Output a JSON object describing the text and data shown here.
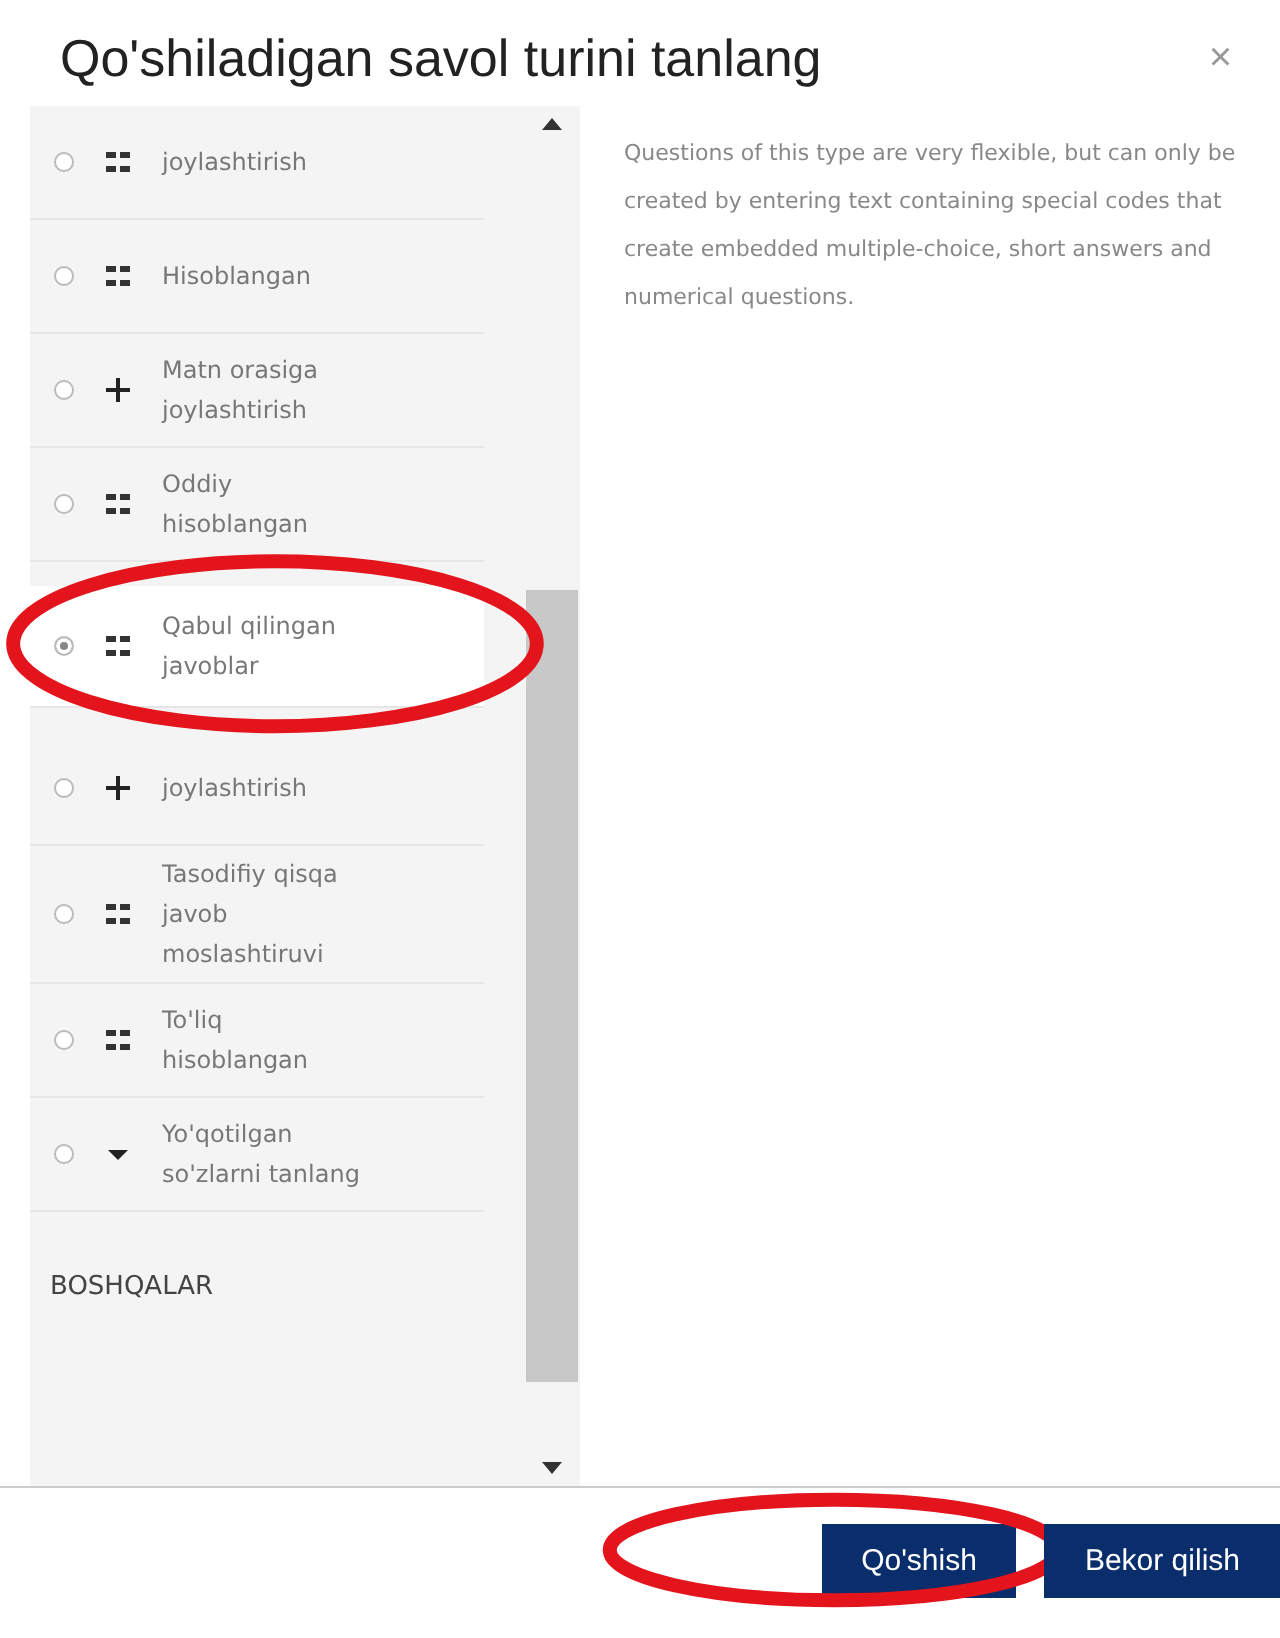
{
  "dialog": {
    "title": "Qo'shiladigan savol turini tanlang",
    "close": "×"
  },
  "question_types": [
    {
      "label": "joylashtirish",
      "selected": false
    },
    {
      "label": "Hisoblangan",
      "selected": false
    },
    {
      "label": "Matn orasiga joylashtirish",
      "selected": false
    },
    {
      "label": "Oddiy hisoblangan",
      "selected": false
    },
    {
      "label": "Qabul qilingan javoblar",
      "selected": true
    },
    {
      "label": "joylashtirish",
      "selected": false
    },
    {
      "label": "Tasodifiy qisqa javob moslashtiruvi",
      "selected": false
    },
    {
      "label": "To'liq hisoblangan",
      "selected": false
    },
    {
      "label": "Yo'qotilgan so'zlarni tanlang",
      "selected": false
    }
  ],
  "section_heading": "BOSHQALAR",
  "description": "Questions of this type are very flexible, but can only be created by entering text containing special codes that create embedded multiple-choice, short answers and numerical questions.",
  "buttons": [
    "Qo'shish",
    "Bekor qilish"
  ]
}
